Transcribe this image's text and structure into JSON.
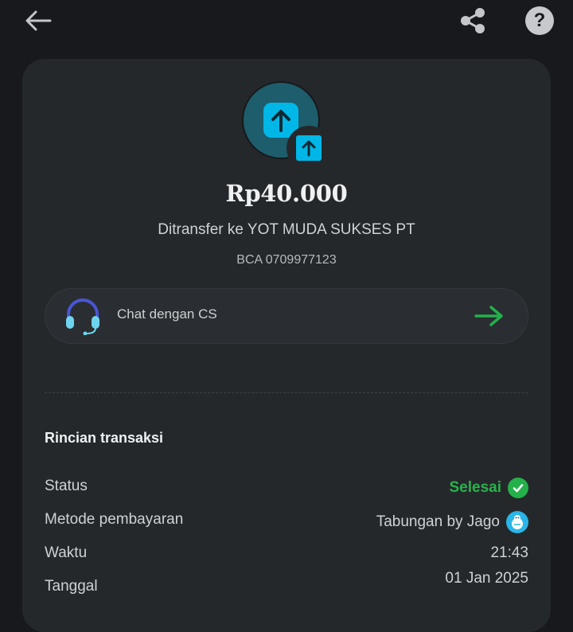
{
  "header": {
    "back_icon": "arrow-left-icon",
    "share_icon": "share-icon",
    "help_label": "?"
  },
  "transaction": {
    "amount": "Rp40.000",
    "recipient_line": "Ditransfer ke YOT MUDA SUKSES PT",
    "account_line": "BCA 0709977123"
  },
  "cs": {
    "label": "Chat dengan CS",
    "icon": "headset-icon",
    "arrow_icon": "arrow-right-icon"
  },
  "details": {
    "title": "Rincian transaksi",
    "rows": [
      {
        "label": "Status",
        "value": "Selesai"
      },
      {
        "label": "Metode pembayaran",
        "value": "Tabungan by Jago"
      },
      {
        "label": "Waktu",
        "value": "21:43"
      },
      {
        "label": "Tanggal",
        "value": "01 Jan 2025"
      }
    ]
  },
  "colors": {
    "background": "#17191c",
    "card": "#25282b",
    "success": "#27b34b",
    "accent_blue": "#00b7e8"
  }
}
